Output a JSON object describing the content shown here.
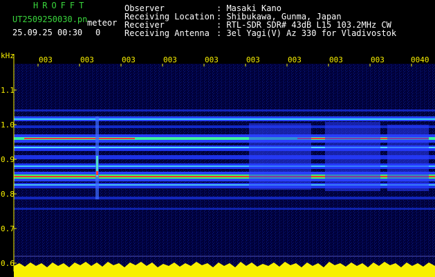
{
  "header": {
    "logo": "HROFFT",
    "file_name": "UT2509250030.pn",
    "detector_label": "meteor",
    "date_time": "25.09.25 00:30",
    "count": "0"
  },
  "info": {
    "observer_label": "Observer",
    "observer_value": ": Masaki Kano",
    "location_label": "Receiving Location",
    "location_value": ": Shibukawa, Gunma, Japan",
    "receiver_label": "Receiver",
    "receiver_value": ": RTL-SDR SDR# 43dB L15 103.2MHz CW",
    "antenna_label": "Receiving Antenna",
    "antenna_value": ": 3el Yagi(V) Az 330 for Vladivostok"
  },
  "axis": {
    "unit_label": "kHz",
    "y_ticks": [
      "1.1",
      "1.0",
      "0.9",
      "0.8",
      "0.7",
      "0.6"
    ],
    "time_ticks": [
      "003",
      "003",
      "003",
      "003",
      "003",
      "003",
      "003",
      "003",
      "003",
      "0040"
    ]
  },
  "colors": {
    "background": "#000000",
    "plot_bg": "#00003a",
    "band_blue": "#2a3cff",
    "band_cyan": "#38e0ff",
    "band_green": "#3cff4c",
    "band_red": "#ff2a2a",
    "noise_yellow": "#f8f000",
    "logo_green": "#39d63c"
  }
}
